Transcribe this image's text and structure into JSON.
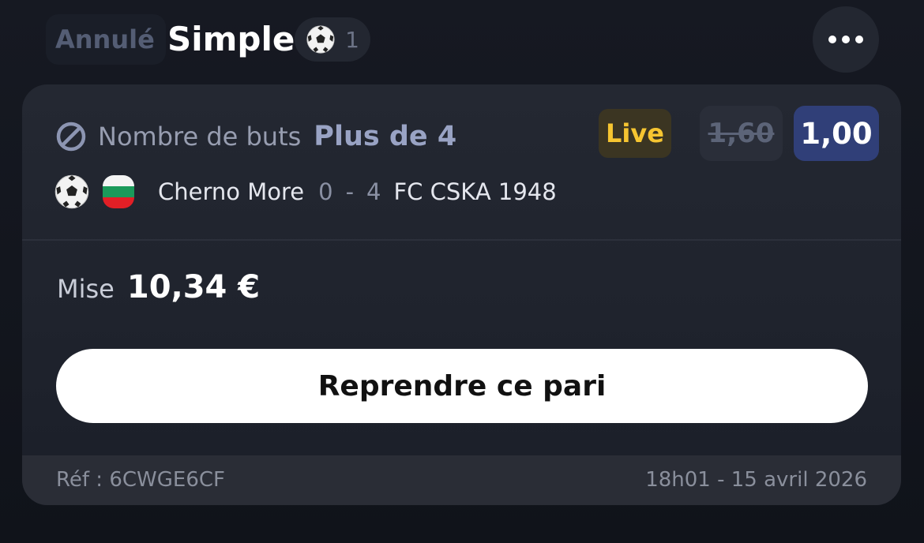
{
  "header": {
    "status": "Annulé",
    "bet_type": "Simple",
    "selection_count": "1"
  },
  "bet": {
    "market": "Nombre de buts",
    "selection": "Plus de 4",
    "live_label": "Live",
    "old_odds": "1,60",
    "new_odds": "1,00",
    "match": {
      "sport_icon": "soccer-ball-icon",
      "country_flag": "bulgaria-flag-icon",
      "home_team": "Cherno More",
      "home_score": "0",
      "separator": "-",
      "away_score": "4",
      "away_team": "FC CSKA 1948"
    },
    "stake_label": "Mise",
    "stake_value": "10,34 €",
    "cta_label": "Reprendre ce pari",
    "reference": "Réf : 6CWGE6CF",
    "datetime": "18h01 - 15 avril 2026"
  },
  "colors": {
    "background": "#12151c",
    "card": "#1f232d",
    "live_text": "#f6c531",
    "odds_active": "#303f78",
    "selection_text": "#99a3c4"
  }
}
